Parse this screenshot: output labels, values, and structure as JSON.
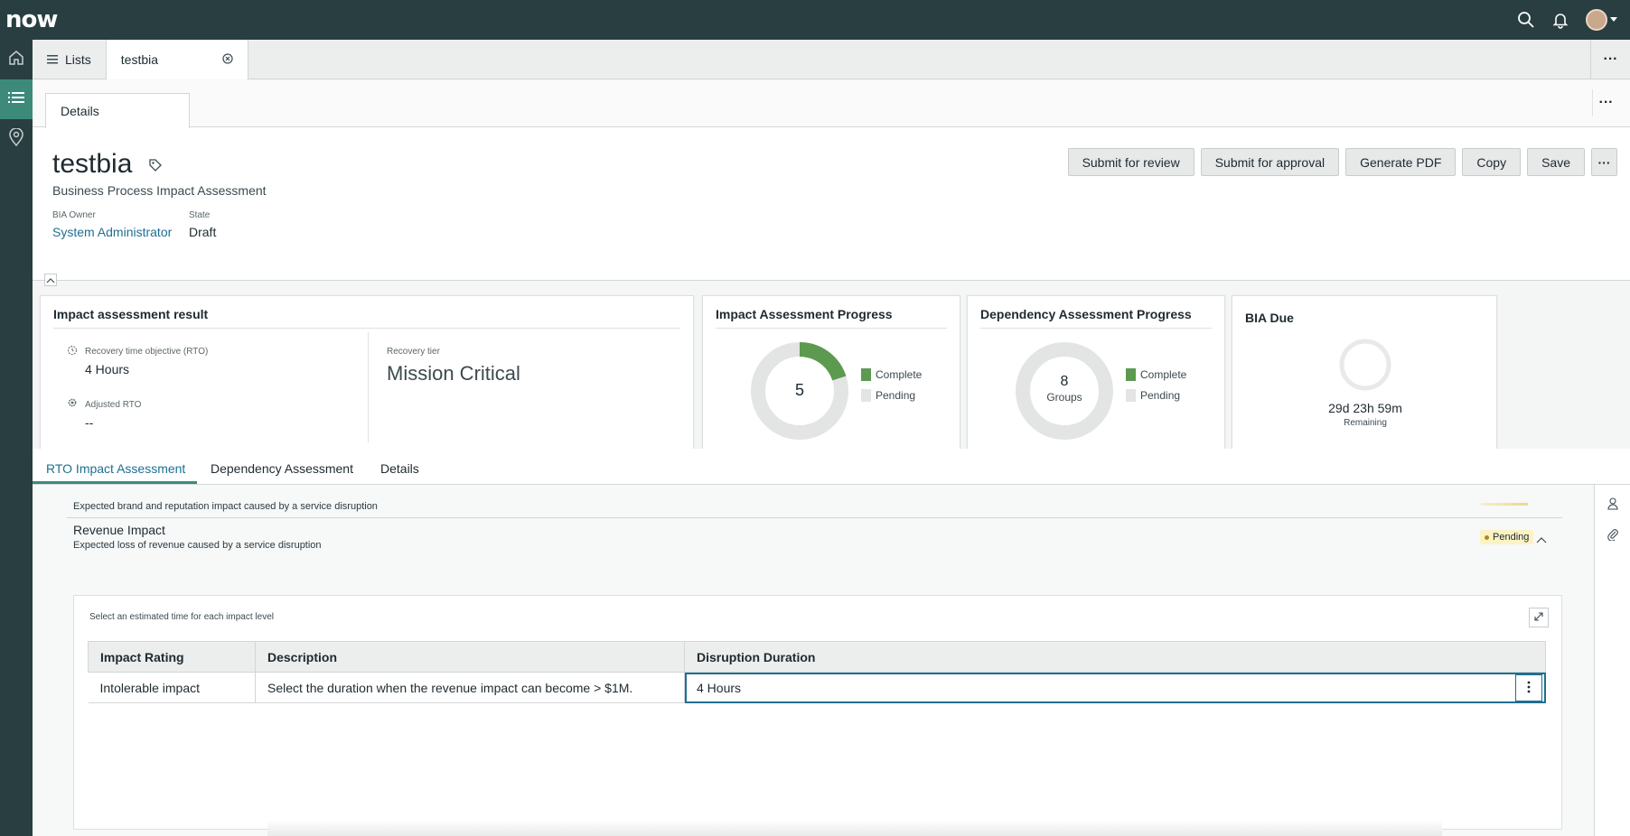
{
  "app": {
    "logo": "now"
  },
  "tabs": [
    {
      "label": "Lists"
    },
    {
      "label": "testbia"
    }
  ],
  "subtab": {
    "label": "Details"
  },
  "record": {
    "title": "testbia",
    "subtitle": "Business Process Impact Assessment",
    "owner_label": "BIA Owner",
    "owner_value": "System Administrator",
    "state_label": "State",
    "state_value": "Draft"
  },
  "actions": {
    "submit_review": "Submit for review",
    "submit_approval": "Submit for approval",
    "generate_pdf": "Generate PDF",
    "copy": "Copy",
    "save": "Save",
    "more": "···"
  },
  "cards": {
    "impact_result": {
      "title": "Impact assessment result",
      "rto_label": "Recovery time objective (RTO)",
      "rto_value": "4 Hours",
      "adjusted_label": "Adjusted RTO",
      "adjusted_value": "--",
      "tier_label": "Recovery tier",
      "tier_value": "Mission Critical"
    },
    "impact_progress": {
      "title": "Impact Assessment Progress",
      "center": "5",
      "complete_fraction": 0.2,
      "legend_complete": "Complete",
      "legend_pending": "Pending"
    },
    "dependency_progress": {
      "title": "Dependency Assessment Progress",
      "center": "8",
      "center_sub": "Groups",
      "complete_fraction": 0,
      "legend_complete": "Complete",
      "legend_pending": "Pending"
    },
    "bia_due": {
      "title": "BIA Due",
      "value": "29d 23h 59m",
      "sub": "Remaining"
    }
  },
  "related_tabs": [
    {
      "label": "RTO Impact Assessment"
    },
    {
      "label": "Dependency Assessment"
    },
    {
      "label": "Details"
    }
  ],
  "rto": {
    "prev_desc": "Expected brand and reputation impact caused by a service disruption",
    "section_title": "Revenue Impact",
    "section_desc": "Expected loss of revenue caused by a service disruption",
    "status": "Pending",
    "instruction": "Select an estimated time for each impact level",
    "columns": [
      "Impact Rating",
      "Description",
      "Disruption Duration"
    ],
    "rows": [
      {
        "rating": "Intolerable impact",
        "description": "Select the duration when the revenue impact can become > $1M.",
        "duration": "4 Hours"
      }
    ]
  },
  "colors": {
    "header": "#293e40",
    "accent": "#3e8a7a",
    "complete": "#5c9a4f",
    "pending": "#e3e4e4",
    "link": "#1f6f91"
  }
}
